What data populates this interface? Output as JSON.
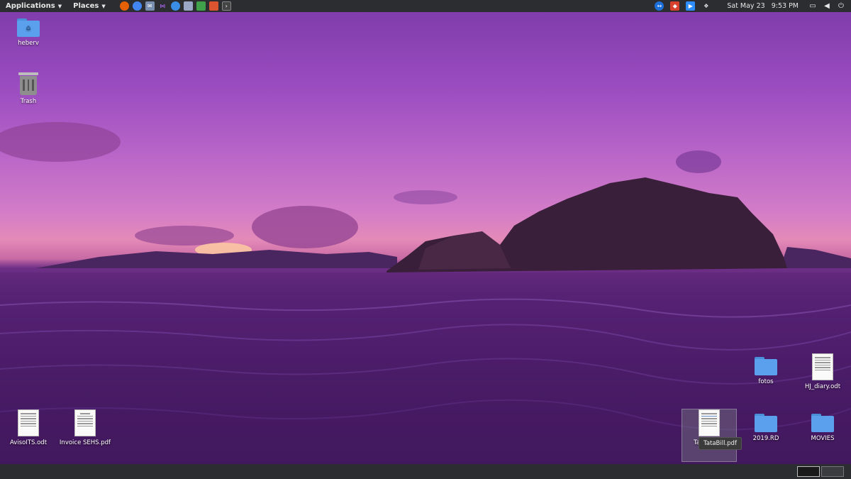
{
  "top_panel": {
    "applications_label": "Applications",
    "places_label": "Places",
    "launchers": [
      {
        "icon": "firefox-icon",
        "color": "#e66000"
      },
      {
        "icon": "chrome-icon",
        "color": "#4285f4"
      },
      {
        "icon": "mail-icon",
        "color": "#7a8fb0"
      },
      {
        "icon": "qt-icon",
        "color": "#8a2be2"
      },
      {
        "icon": "blue-app-icon",
        "color": "#3a8ee6"
      },
      {
        "icon": "text-editor-icon",
        "color": "#9aa7c7"
      },
      {
        "icon": "spreadsheet-icon",
        "color": "#3fa14a"
      },
      {
        "icon": "presentation-icon",
        "color": "#d9542f"
      },
      {
        "icon": "terminal-icon",
        "color": "#444444"
      }
    ],
    "tray": [
      {
        "icon": "teamviewer-icon",
        "color": "#1c6fd9"
      },
      {
        "icon": "anydesk-icon",
        "color": "#d9412f"
      },
      {
        "icon": "zoom-icon",
        "color": "#2d8cff"
      },
      {
        "icon": "dropbox-icon",
        "color": "#2b2d30"
      }
    ],
    "clock": "Sat May 23   9:53 PM"
  },
  "desktop": {
    "home_folder": "heberv",
    "trash": "Trash",
    "fotos": "fotos",
    "hj_diary": "HJ_diary.odt",
    "aviso": "AvisoITS.odt",
    "invoice": "Invoice SEHS.pdf",
    "tata_partial": "Ta",
    "tata_tooltip": "TataBill.pdf",
    "rd": "2019.RD",
    "movies": "MOVIES"
  },
  "colors": {
    "panel_bg": "#2b2d30",
    "folder_blue": "#5aa0ec"
  }
}
